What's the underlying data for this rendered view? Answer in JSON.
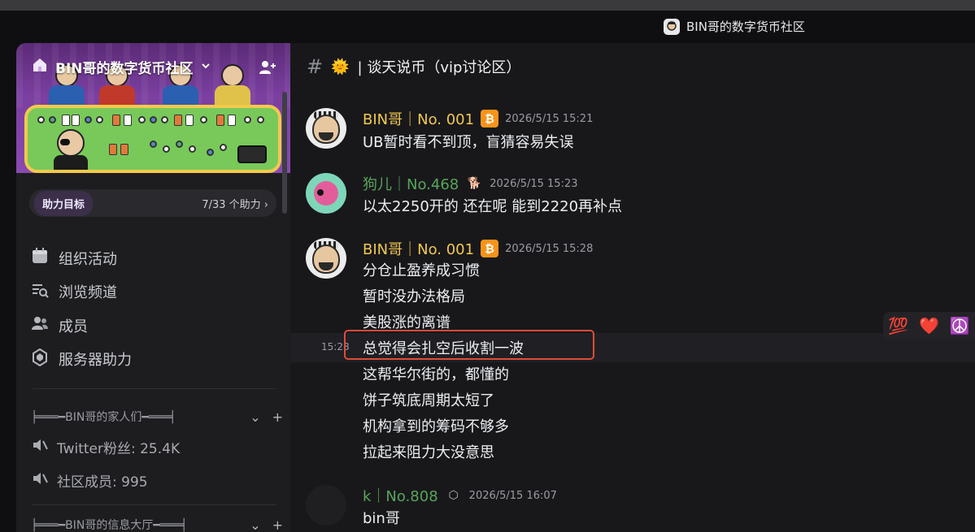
{
  "window": {
    "title": "BIN哥的数字货币社区"
  },
  "sidebar": {
    "server_name": "BIN哥的数字货币社区",
    "boost": {
      "label": "助力目标",
      "count": "7/33 个助力"
    },
    "nav": [
      {
        "label": "组织活动",
        "icon": "calendar-icon"
      },
      {
        "label": "浏览频道",
        "icon": "browse-channels-icon"
      },
      {
        "label": "成员",
        "icon": "members-icon"
      },
      {
        "label": "服务器助力",
        "icon": "boost-icon"
      }
    ],
    "categories": [
      {
        "label": "╞═══━BIN哥的家人们━═══╡",
        "channels": [
          {
            "label": "Twitter粉丝: 25.4K",
            "icon": "speaker-muted-icon"
          },
          {
            "label": "社区成员: 995",
            "icon": "speaker-muted-icon"
          }
        ]
      },
      {
        "label": "╞═══━BIN哥的信息大厅━═══╡",
        "channels": []
      }
    ]
  },
  "channel": {
    "name": "| 谈天说币（vip讨论区）",
    "emoji": "🌞"
  },
  "messages": [
    {
      "author": "BIN哥｜No. 001",
      "author_color": "#f2c94c",
      "badge": "₿",
      "timestamp": "2026/5/15 15:21",
      "lines": [
        "UB暂时看不到顶，盲猜容易失误"
      ]
    },
    {
      "author": "狗儿｜No.468",
      "author_color": "#57a55a",
      "badge": "🐕",
      "timestamp": "2026/5/15 15:23",
      "lines": [
        "以太2250开的 还在呢 能到2220再补点"
      ]
    },
    {
      "author": "BIN哥｜No. 001",
      "author_color": "#f2c94c",
      "badge": "₿",
      "timestamp": "2026/5/15 15:28",
      "lines": [
        "分仓止盈养成习惯",
        "暂时没办法格局",
        "美股涨的离谱",
        "总觉得会扎空后收割一波",
        "这帮华尔街的，都懂的",
        "饼子筑底周期太短了",
        "机构拿到的筹码不够多",
        "拉起来阻力大没意思"
      ]
    },
    {
      "author": "k｜No.808",
      "author_color": "#57a55a",
      "badge": "⬡",
      "timestamp": "2026/5/15 16:07",
      "lines": [
        "bin哥"
      ]
    }
  ],
  "hover_timestamp": "15:28",
  "reactions": [
    "💯",
    "❤️",
    "☮️"
  ],
  "colors": {
    "highlight_border": "#e04b3a",
    "gold_name": "#f2c94c",
    "green_name": "#57a55a"
  }
}
